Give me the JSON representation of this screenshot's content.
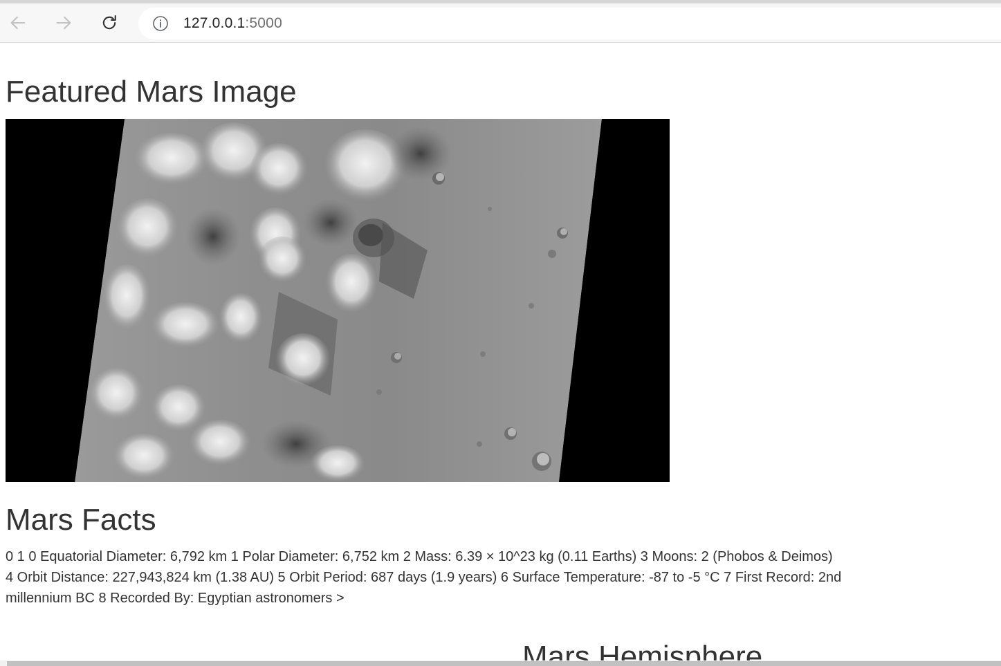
{
  "browser": {
    "url_host": "127.0.0.1",
    "url_port": ":5000",
    "icons": {
      "back": "arrow-left-icon",
      "forward": "arrow-right-icon",
      "reload": "reload-icon",
      "site_info": "info-icon"
    }
  },
  "page": {
    "featured_title": "Featured Mars Image",
    "facts_title": "Mars Facts",
    "facts_text": "0 1 0 Equatorial Diameter: 6,792 km 1 Polar Diameter: 6,752 km 2 Mass: 6.39 × 10^23 kg (0.11 Earths) 3 Moons: 2 (Phobos & Deimos) 4 Orbit Distance: 227,943,824 km (1.38 AU) 5 Orbit Period: 687 days (1.9 years) 6 Surface Temperature: -87 to -5 °C 7 First Record: 2nd millennium BC 8 Recorded By: Egyptian astronomers >",
    "hemisphere_title": "Mars Hemisphere"
  },
  "colors": {
    "text": "#333333",
    "image_background": "#000000",
    "terrain": "#8a8a8a"
  }
}
